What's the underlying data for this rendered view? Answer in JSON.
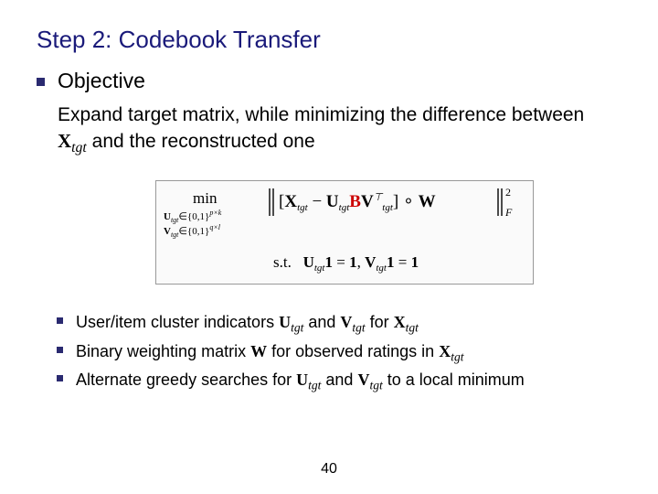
{
  "title": "Step 2: Codebook Transfer",
  "section_label": "Objective",
  "description_parts": {
    "pre": "Expand target matrix, while minimizing the difference between ",
    "var_X": "X",
    "var_sub": "tgt",
    "post": " and the reconstructed one"
  },
  "formula": {
    "min_over_U": "U_{tgt} ∈ {0,1}^{p×k}",
    "min_over_V": "V_{tgt} ∈ {0,1}^{q×l}",
    "expr": "‖[X_{tgt} − U_{tgt} B V_{tgt}ᵀ] ∘ W‖²_F",
    "constraint": "s.t.  U_{tgt} 1 = 1,  V_{tgt} 1 = 1"
  },
  "bullets": [
    {
      "parts": [
        "User/item cluster indicators ",
        {
          "v": "U",
          "s": "tgt"
        },
        " and ",
        {
          "v": "V",
          "s": "tgt"
        },
        " for ",
        {
          "v": "X",
          "s": "tgt"
        }
      ]
    },
    {
      "parts": [
        "Binary weighting matrix ",
        {
          "v": "W"
        },
        " for observed ratings in ",
        {
          "v": "X",
          "s": "tgt"
        }
      ]
    },
    {
      "parts": [
        "Alternate greedy searches for ",
        {
          "v": "U",
          "s": "tgt"
        },
        " and ",
        {
          "v": "V",
          "s": "tgt"
        },
        " to a local minimum"
      ]
    }
  ],
  "page_number": "40"
}
